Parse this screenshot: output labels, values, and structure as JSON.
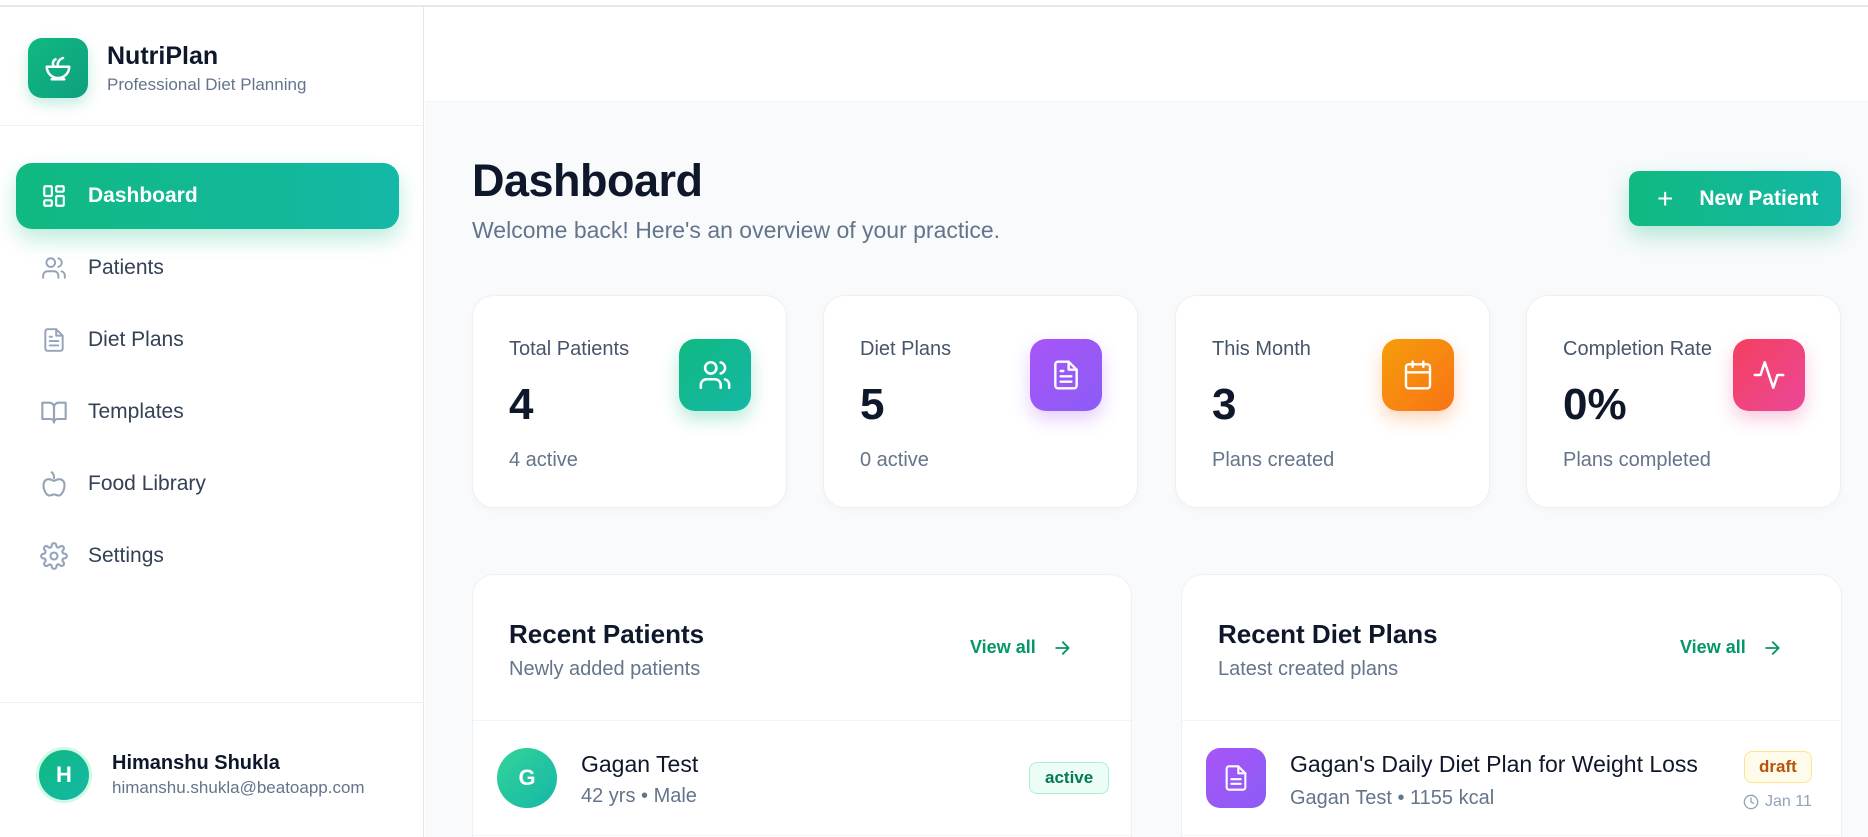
{
  "brand": {
    "name": "NutriPlan",
    "subtitle": "Professional Diet Planning",
    "icon": "salad-bowl-icon"
  },
  "sidebar": {
    "items": [
      {
        "label": "Dashboard",
        "icon": "dashboard-grid-icon",
        "active": true
      },
      {
        "label": "Patients",
        "icon": "users-icon",
        "active": false
      },
      {
        "label": "Diet Plans",
        "icon": "file-text-icon",
        "active": false
      },
      {
        "label": "Templates",
        "icon": "book-open-icon",
        "active": false
      },
      {
        "label": "Food Library",
        "icon": "apple-icon",
        "active": false
      },
      {
        "label": "Settings",
        "icon": "gear-icon",
        "active": false
      }
    ]
  },
  "user": {
    "initial": "H",
    "name": "Himanshu Shukla",
    "email": "himanshu.shukla@beatoapp.com"
  },
  "page": {
    "title": "Dashboard",
    "subtitle": "Welcome back! Here's an overview of your practice.",
    "new_button_label": "New Patient"
  },
  "stats": [
    {
      "label": "Total Patients",
      "value": "4",
      "sub": "4 active",
      "icon": "users-icon",
      "color": "#10b981"
    },
    {
      "label": "Diet Plans",
      "value": "5",
      "sub": "0 active",
      "icon": "file-text-icon",
      "color": "#a855f7"
    },
    {
      "label": "This Month",
      "value": "3",
      "sub": "Plans created",
      "icon": "calendar-icon",
      "color": "#f97316"
    },
    {
      "label": "Completion Rate",
      "value": "0%",
      "sub": "Plans completed",
      "icon": "activity-icon",
      "color": "#ec4899"
    }
  ],
  "recent_patients": {
    "title": "Recent Patients",
    "subtitle": "Newly added patients",
    "view_all": "View all",
    "items": [
      {
        "initial": "G",
        "name": "Gagan Test",
        "meta": "42 yrs • Male",
        "status": "active"
      }
    ]
  },
  "recent_plans": {
    "title": "Recent Diet Plans",
    "subtitle": "Latest created plans",
    "view_all": "View all",
    "items": [
      {
        "title": "Gagan's Daily Diet Plan for Weight Loss",
        "meta": "Gagan Test • 1155 kcal",
        "status": "draft",
        "date": "Jan 11"
      }
    ]
  },
  "colors": {
    "accent": "#10b981",
    "accent2": "#14b8a6",
    "text": "#0f172a",
    "muted": "#64748b"
  }
}
